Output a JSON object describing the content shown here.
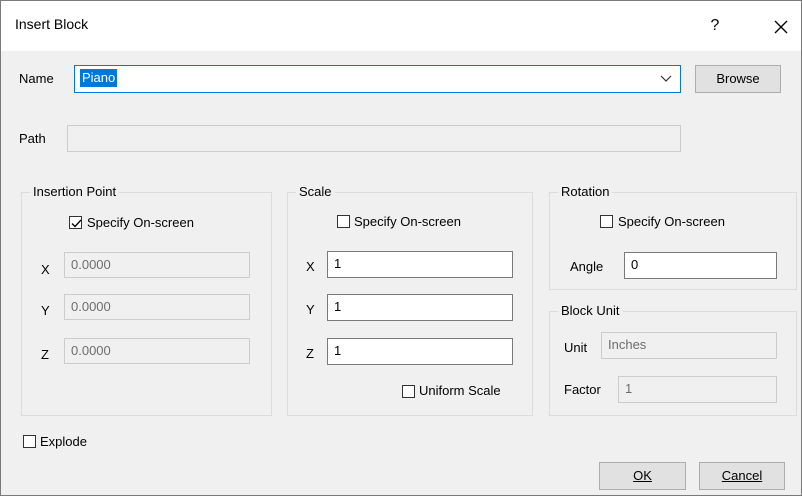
{
  "window": {
    "title": "Insert Block",
    "help": "?",
    "close": "✕"
  },
  "name": {
    "label": "Name",
    "value": "Piano",
    "browse": "Browse"
  },
  "path": {
    "label": "Path",
    "value": ""
  },
  "insertion": {
    "title": "Insertion Point",
    "specify_label": "Specify On-screen",
    "specify_checked": true,
    "x_label": "X",
    "x_value": "0.0000",
    "y_label": "Y",
    "y_value": "0.0000",
    "z_label": "Z",
    "z_value": "0.0000"
  },
  "scale": {
    "title": "Scale",
    "specify_label": "Specify On-screen",
    "specify_checked": false,
    "x_label": "X",
    "x_value": "1",
    "y_label": "Y",
    "y_value": "1",
    "z_label": "Z",
    "z_value": "1",
    "uniform_label": "Uniform Scale",
    "uniform_checked": false
  },
  "rotation": {
    "title": "Rotation",
    "specify_label": "Specify On-screen",
    "specify_checked": false,
    "angle_label": "Angle",
    "angle_value": "0"
  },
  "block_unit": {
    "title": "Block Unit",
    "unit_label": "Unit",
    "unit_value": "Inches",
    "factor_label": "Factor",
    "factor_value": "1"
  },
  "explode": {
    "label": "Explode",
    "checked": false
  },
  "buttons": {
    "ok": "OK",
    "cancel": "Cancel"
  },
  "colors": {
    "accent": "#0078d7",
    "button_bg": "#e1e1e1",
    "dialog_bg": "#f0f0f0"
  }
}
